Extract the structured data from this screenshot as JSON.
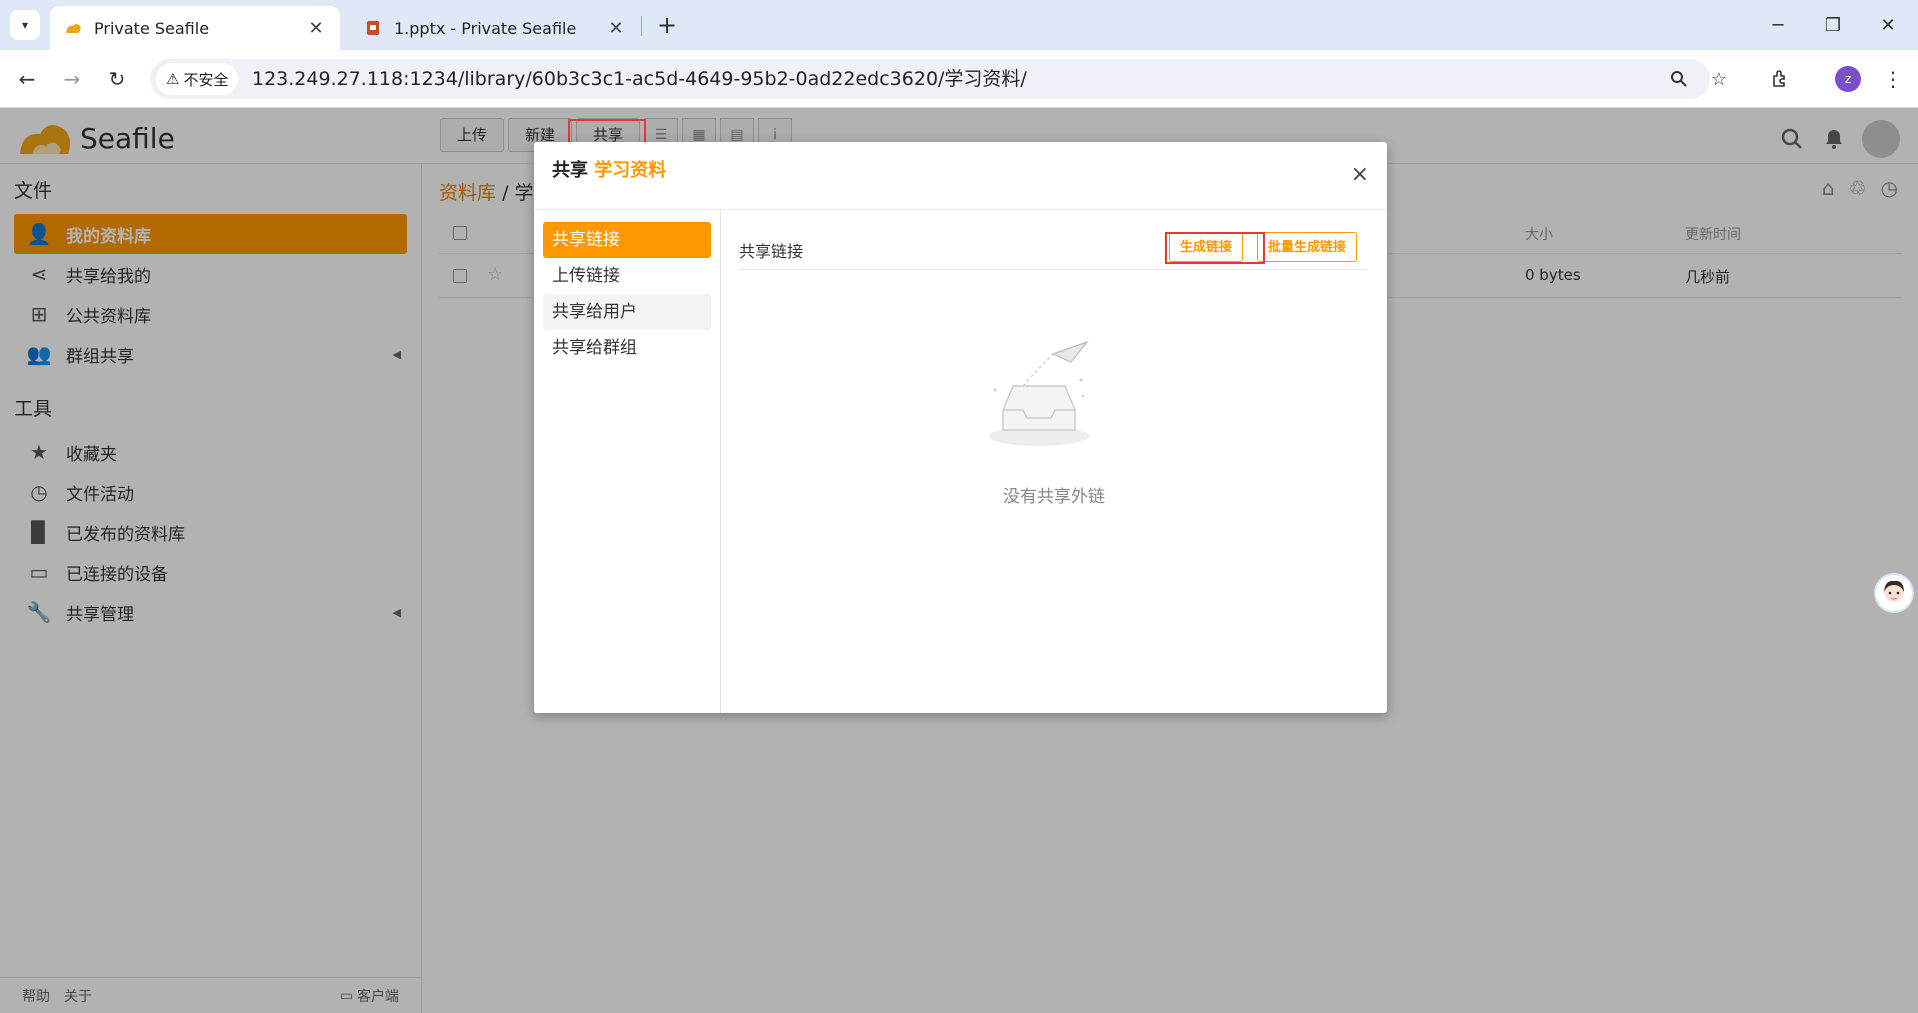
{
  "browser": {
    "tabs": [
      {
        "title": "Private Seafile",
        "close": "✕"
      },
      {
        "title": "1.pptx - Private Seafile",
        "close": "✕"
      }
    ],
    "new_tab": "+",
    "security_label": "不安全",
    "url": "123.249.27.118:1234/library/60b3c3c1-ac5d-4649-95b2-0ad22edc3620/学习资料/",
    "profile_letter": "z"
  },
  "app": {
    "logo_text": "Seafile",
    "toolbar": {
      "upload": "上传",
      "new": "新建",
      "share": "共享"
    },
    "sidebar": {
      "files_heading": "文件",
      "files_items": [
        {
          "label": "我的资料库",
          "icon": "user-icon"
        },
        {
          "label": "共享给我的",
          "icon": "share-icon"
        },
        {
          "label": "公共资料库",
          "icon": "org-icon"
        },
        {
          "label": "群组共享",
          "icon": "group-icon"
        }
      ],
      "tools_heading": "工具",
      "tools_items": [
        {
          "label": "收藏夹",
          "icon": "star-icon"
        },
        {
          "label": "文件活动",
          "icon": "clock-icon"
        },
        {
          "label": "已发布的资料库",
          "icon": "book-icon"
        },
        {
          "label": "已连接的设备",
          "icon": "monitor-icon"
        },
        {
          "label": "共享管理",
          "icon": "wrench-icon"
        }
      ],
      "footer": {
        "help": "帮助",
        "about": "关于",
        "client": "客户端"
      }
    },
    "breadcrumb": {
      "root": "资料库",
      "sep": "/",
      "current": "学"
    },
    "table": {
      "headers": {
        "size": "大小",
        "mtime": "更新时间"
      },
      "rows": [
        {
          "size": "0 bytes",
          "mtime": "几秒前"
        }
      ]
    }
  },
  "modal": {
    "title_prefix": "共享",
    "title_object": "学习资料",
    "close": "×",
    "nav": [
      "共享链接",
      "上传链接",
      "共享给用户",
      "共享给群组"
    ],
    "body_title": "共享链接",
    "generate_btn": "生成链接",
    "batch_btn": "批量生成链接",
    "empty_text": "没有共享外链"
  },
  "colors": {
    "accent": "#ff9800",
    "annotation": "#e53935"
  }
}
